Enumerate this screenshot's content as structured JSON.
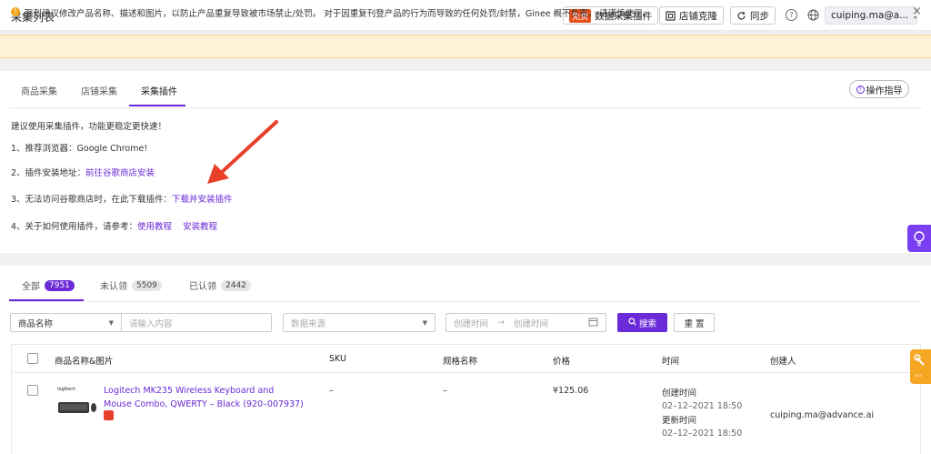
{
  "header": {
    "title": "采集列表",
    "free_badge": "免费",
    "data_plugin_label": "数据采集插件",
    "store_clone_label": "店铺克隆",
    "sync_label": "同步",
    "user_label": "cuiping.ma@a..."
  },
  "notice": {
    "text": "强烈建议修改产品名称、描述和图片，以防止产品重复导致被市场禁止/处罚。 对于因重复刊登产品的行为而导致的任何处罚/封禁，Ginee 概不负责。 请谨慎使用。"
  },
  "tabs": [
    {
      "label": "商品采集"
    },
    {
      "label": "店铺采集"
    },
    {
      "label": "采集插件"
    }
  ],
  "guide_label": "操作指导",
  "plugin_info": {
    "intro": "建议使用采集插件，功能更稳定更快速！",
    "line1": "1、推荐浏览器：Google Chrome!",
    "line2_prefix": "2、插件安装地址：",
    "line2_link": "前往谷歌商店安装",
    "line3_prefix": "3、无法访问谷歌商店时，在此下载插件：",
    "line3_link": "下载并安装插件",
    "line4_prefix": "4、关于如何使用插件，请参考：",
    "line4_link1": "使用教程",
    "line4_link2": "安装教程"
  },
  "status_tabs": [
    {
      "label": "全部",
      "count": "7951"
    },
    {
      "label": "未认领",
      "count": "5509"
    },
    {
      "label": "已认领",
      "count": "2442"
    }
  ],
  "filters": {
    "field_select": "商品名称",
    "search_placeholder": "请输入内容",
    "source_placeholder": "数据来源",
    "start_placeholder": "创建时间",
    "end_placeholder": "创建时间",
    "search_button": "搜索",
    "reset_button": "重 置"
  },
  "table": {
    "columns": [
      "商品名称&图片",
      "SKU",
      "规格名称",
      "价格",
      "时间",
      "创建人"
    ],
    "rows": [
      {
        "name": "Logitech MK235 Wireless Keyboard and Mouse Combo, QWERTY – Black (920–007937)",
        "sku": "–",
        "spec": "–",
        "price": "¥125.06",
        "created_label": "创建时间",
        "created": "02–12–2021 18:50",
        "updated_label": "更新时间",
        "updated": "02–12–2021 18:50",
        "creator": "cuiping.ma@advance.ai",
        "image_brand": "logitech"
      }
    ]
  },
  "colors": {
    "accent": "#6a2ad8",
    "warning_bg": "#fef1d4",
    "badge_red": "#e8501c",
    "arrow": "#e8402a"
  }
}
